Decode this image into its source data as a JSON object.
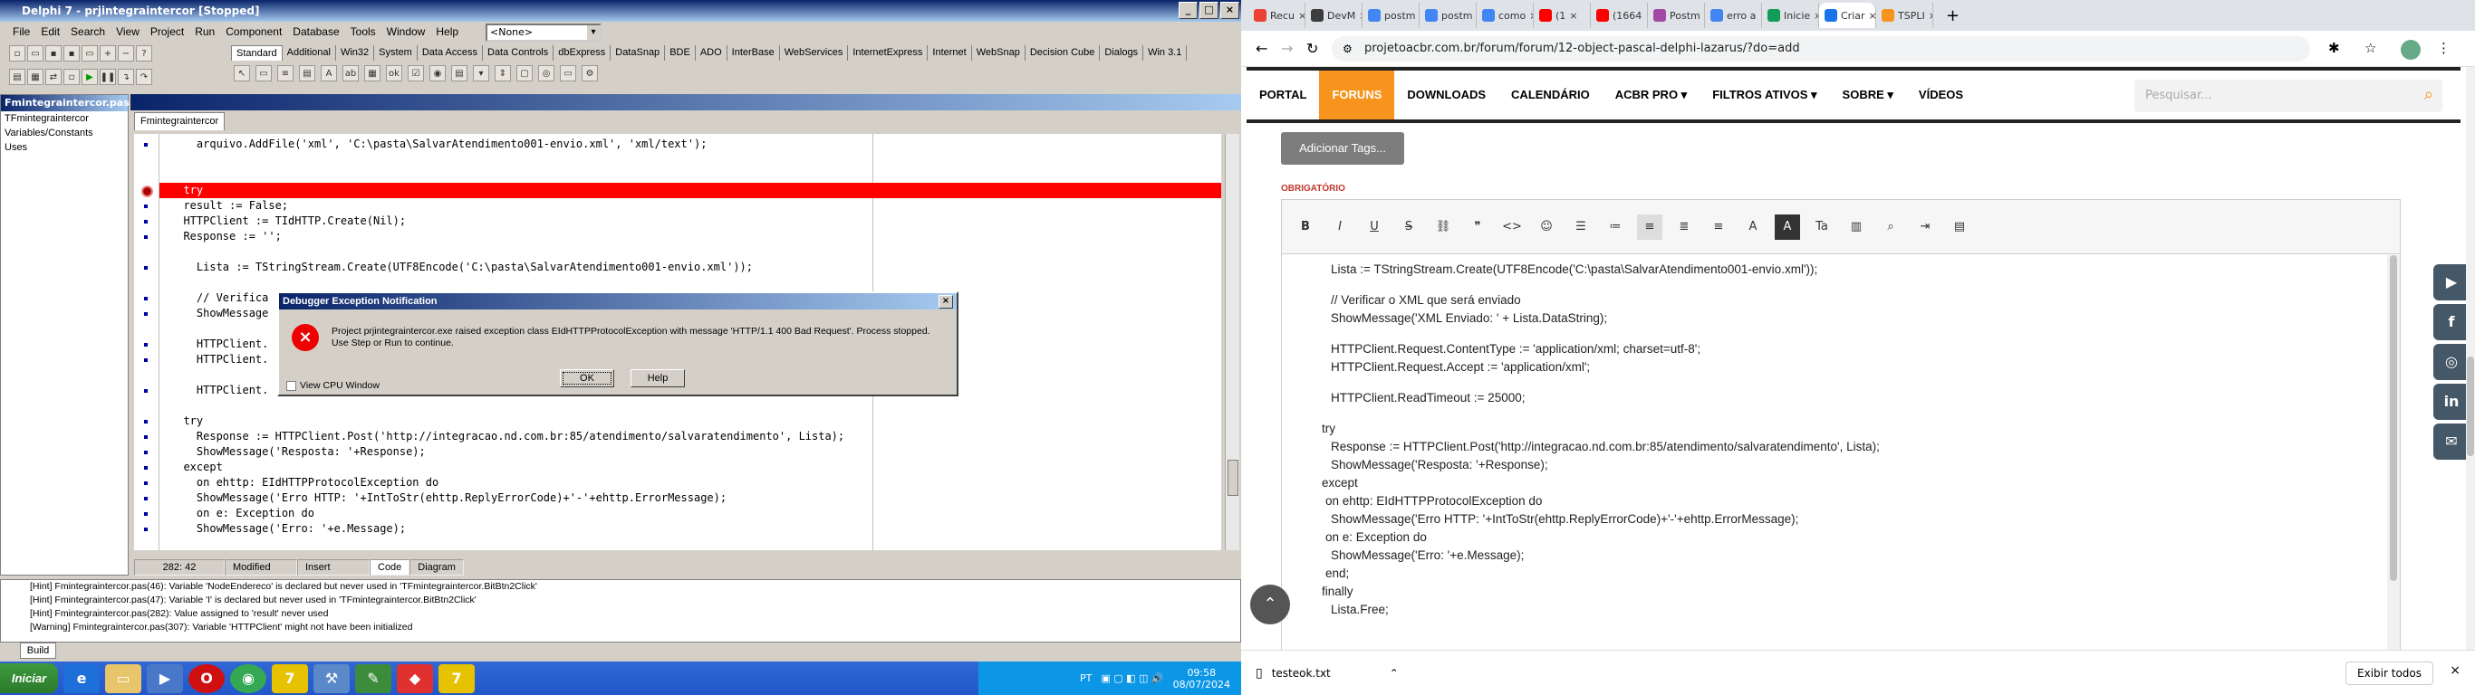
{
  "delphi": {
    "title": "Delphi 7 - prjintegraintercor [Stopped]",
    "menu": [
      "File",
      "Edit",
      "Search",
      "View",
      "Project",
      "Run",
      "Component",
      "Database",
      "Tools",
      "Window",
      "Help"
    ],
    "combo_value": "<None>",
    "palette_tabs": [
      "Standard",
      "Additional",
      "Win32",
      "System",
      "Data Access",
      "Data Controls",
      "dbExpress",
      "DataSnap",
      "BDE",
      "ADO",
      "InterBase",
      "WebServices",
      "InternetExpress",
      "Internet",
      "WebSnap",
      "Decision Cube",
      "Dialogs",
      "Win 3.1"
    ],
    "active_palette_tab": "Standard",
    "explorer_title": "Fmintegraintercor.pas",
    "tree": [
      "TFmintegraintercor",
      "Variables/Constants",
      "Uses"
    ],
    "editor_tab": "Fmintegraintercor",
    "code_lines": [
      "    arquivo.AddFile('xml', 'C:\\pasta\\SalvarAtendimento001-envio.xml', 'xml/text');",
      "",
      "",
      "  try",
      "  result := False;",
      "  HTTPClient := TIdHTTP.Create(Nil);",
      "  Response := '';",
      "",
      "    Lista := TStringStream.Create(UTF8Encode('C:\\pasta\\SalvarAtendimento001-envio.xml'));",
      "",
      "    // Verifica",
      "    ShowMessage",
      "",
      "    HTTPClient.",
      "    HTTPClient.",
      "",
      "    HTTPClient.",
      "",
      "  try",
      "    Response := HTTPClient.Post('http://integracao.nd.com.br:85/atendimento/salvaratendimento', Lista);",
      "    ShowMessage('Resposta: '+Response);",
      "  except",
      "    on ehttp: EIdHTTPProtocolException do",
      "    ShowMessage('Erro HTTP: '+IntToStr(ehttp.ReplyErrorCode)+'-'+ehttp.ErrorMessage);",
      "    on e: Exception do",
      "    ShowMessage('Erro: '+e.Message);"
    ],
    "status": {
      "position": "282: 42",
      "modified": "Modified",
      "mode": "Insert",
      "tabs": [
        "Code",
        "Diagram"
      ]
    },
    "messages": [
      "[Hint] Fmintegraintercor.pas(46): Variable 'NodeEndereco' is declared but never used in 'TFmintegraintercor.BitBtn2Click'",
      "[Hint] Fmintegraintercor.pas(47): Variable 'I' is declared but never used in 'TFmintegraintercor.BitBtn2Click'",
      "[Hint] Fmintegraintercor.pas(282): Value assigned to 'result' never used",
      "[Warning] Fmintegraintercor.pas(307): Variable 'HTTPClient' might not have been initialized"
    ],
    "build_tab": "Build",
    "dialog": {
      "title": "Debugger Exception Notification",
      "message": "Project prjintegraintercor.exe raised exception class EIdHTTPProtocolException with message 'HTTP/1.1 400 Bad Request'. Process stopped. Use Step or Run to continue.",
      "checkbox": "View CPU Window",
      "ok": "OK",
      "help": "Help"
    }
  },
  "taskbar": {
    "start": "Iniciar",
    "lang": "PT",
    "time": "09:58",
    "date": "08/07/2024"
  },
  "chrome": {
    "tabs": [
      "Recu",
      "DevM",
      "postm",
      "postm",
      "como",
      "(1",
      "(1664",
      "Postm",
      "erro a",
      "Inicie",
      "Criar",
      "TSPLI"
    ],
    "tab_favicon_colors": [
      "#ea4335",
      "#3c3c3c",
      "#4285f4",
      "#4285f4",
      "#4285f4",
      "#ff0000",
      "#ff0000",
      "#a349a4",
      "#4285f4",
      "#0f9d58",
      "#1a73e8",
      "#f7941d"
    ],
    "url": "projetoacbr.com.br/forum/forum/12-object-pascal-delphi-lazarus/?do=add",
    "nav": [
      "PORTAL",
      "FORUNS",
      "DOWNLOADS",
      "CALENDÁRIO",
      "ACBR PRO ▾",
      "FILTROS ATIVOS ▾",
      "SOBRE ▾",
      "VÍDEOS"
    ],
    "active_nav": "FORUNS",
    "search_placeholder": "Pesquisar...",
    "add_tags": "Adicionar Tags...",
    "required": "OBRIGATÓRIO",
    "text_lines": [
      "Lista := TStringStream.Create(UTF8Encode('C:\\pasta\\SalvarAtendimento001-envio.xml'));",
      "// Verificar o XML que será enviado",
      "ShowMessage('XML Enviado: ' + Lista.DataString);",
      "HTTPClient.Request.ContentType := 'application/xml; charset=utf-8';",
      "HTTPClient.Request.Accept := 'application/xml';",
      "HTTPClient.ReadTimeout := 25000;",
      "try",
      "Response := HTTPClient.Post('http://integracao.nd.com.br:85/atendimento/salvaratendimento', Lista);",
      "ShowMessage('Resposta: '+Response);",
      "except",
      "on ehttp: EIdHTTPProtocolException do",
      "ShowMessage('Erro HTTP: '+IntToStr(ehttp.ReplyErrorCode)+'-'+ehttp.ErrorMessage);",
      "on e: Exception do",
      "ShowMessage('Erro: '+e.Message);",
      "end;",
      "finally",
      "Lista.Free;"
    ],
    "download_file": "testeok.txt",
    "show_all": "Exibir todos",
    "accent": "#f7941d"
  }
}
